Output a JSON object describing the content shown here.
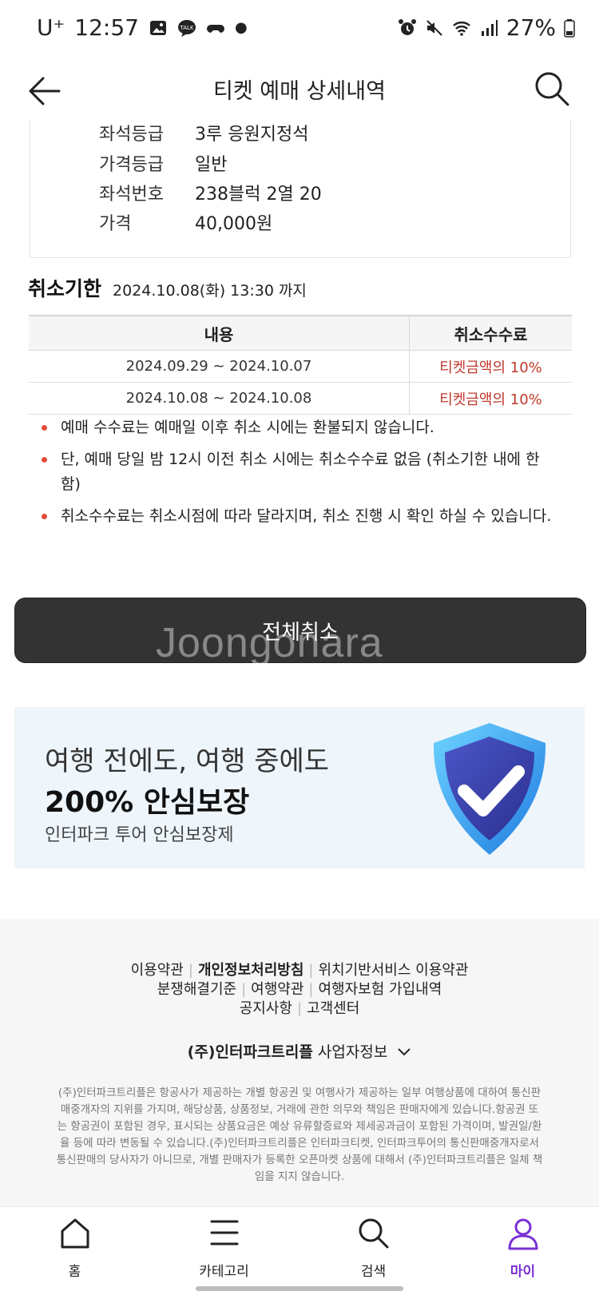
{
  "status_bar": {
    "carrier": "U⁺",
    "time": "12:57",
    "talk_badge": "TALK",
    "battery": "27%"
  },
  "header": {
    "title": "티켓 예매 상세내역"
  },
  "seat_info": {
    "rows": [
      {
        "label": "좌석등급",
        "value": "3루 응원지정석"
      },
      {
        "label": "가격등급",
        "value": "일반"
      },
      {
        "label": "좌석번호",
        "value": "238블럭 2열 20"
      },
      {
        "label": "가격",
        "value": "40,000원"
      }
    ]
  },
  "cancel_deadline": {
    "title": "취소기한",
    "date": "2024.10.08(화) 13:30 까지"
  },
  "fee_table": {
    "headers": [
      "내용",
      "취소수수료"
    ],
    "rows": [
      {
        "period": "2024.09.29 ~ 2024.10.07",
        "fee": "티켓금액의 10%"
      },
      {
        "period": "2024.10.08 ~ 2024.10.08",
        "fee": "티켓금액의 10%"
      }
    ]
  },
  "notes": [
    "예매 수수료는 예매일 이후 취소 시에는 환불되지 않습니다.",
    "단, 예매 당일 밤 12시 이전 취소 시에는 취소수수료 없음 (취소기한 내에 한함)",
    "취소수수료는 취소시점에 따라 달라지며, 취소 진행 시 확인 하실 수 있습니다."
  ],
  "cancel_button": {
    "label": "전체취소"
  },
  "watermark": "Joongonara",
  "banner": {
    "line1": "여행 전에도, 여행 중에도",
    "line2": "200% 안심보장",
    "line3": "인터파크 투어 안심보장제"
  },
  "footer": {
    "links_row1": [
      "이용약관",
      "개인정보처리방침",
      "위치기반서비스 이용약관"
    ],
    "links_row2": [
      "분쟁해결기준",
      "여행약관",
      "여행자보험 가입내역"
    ],
    "links_row3": [
      "공지사항",
      "고객센터"
    ],
    "company_name": "(주)인터파크트리플",
    "company_info_toggle": "사업자정보",
    "disclaimer": "(주)인터파크트리플은 항공사가 제공하는 개별 항공권 및 여행사가 제공하는 일부 여행상품에 대하여 통신판매중개자의 지위를 가지며, 해당상품, 상품정보, 거래에 관한 의무와 책임은 판매자에게 있습니다.항공권 또는 항공권이 포함된 경우, 표시되는 상품요금은 예상 유류할증료와 제세공과금이 포함된 가격이며, 발권일/환율 등에 따라 변동될 수 있습니다.(주)인터파크트리플은 인터파크티켓, 인터파크투어의 통신판매중개자로서 통신판매의 당사자가 아니므로, 개별 판매자가 등록한 오픈마켓 상품에 대해서 (주)인터파크트리플은 일체 책임을 지지 않습니다."
  },
  "tabbar": {
    "tabs": [
      {
        "label": "홈",
        "icon": "home-icon"
      },
      {
        "label": "카테고리",
        "icon": "menu-icon"
      },
      {
        "label": "검색",
        "icon": "search-icon"
      },
      {
        "label": "마이",
        "icon": "person-icon",
        "active": true
      }
    ]
  },
  "colors": {
    "accent": "#7a2fd6",
    "fee_red": "#c0392b",
    "bullet_red": "#e74c3c",
    "cancel_button_bg": "#333333",
    "banner_bg": "#eef5fb"
  }
}
